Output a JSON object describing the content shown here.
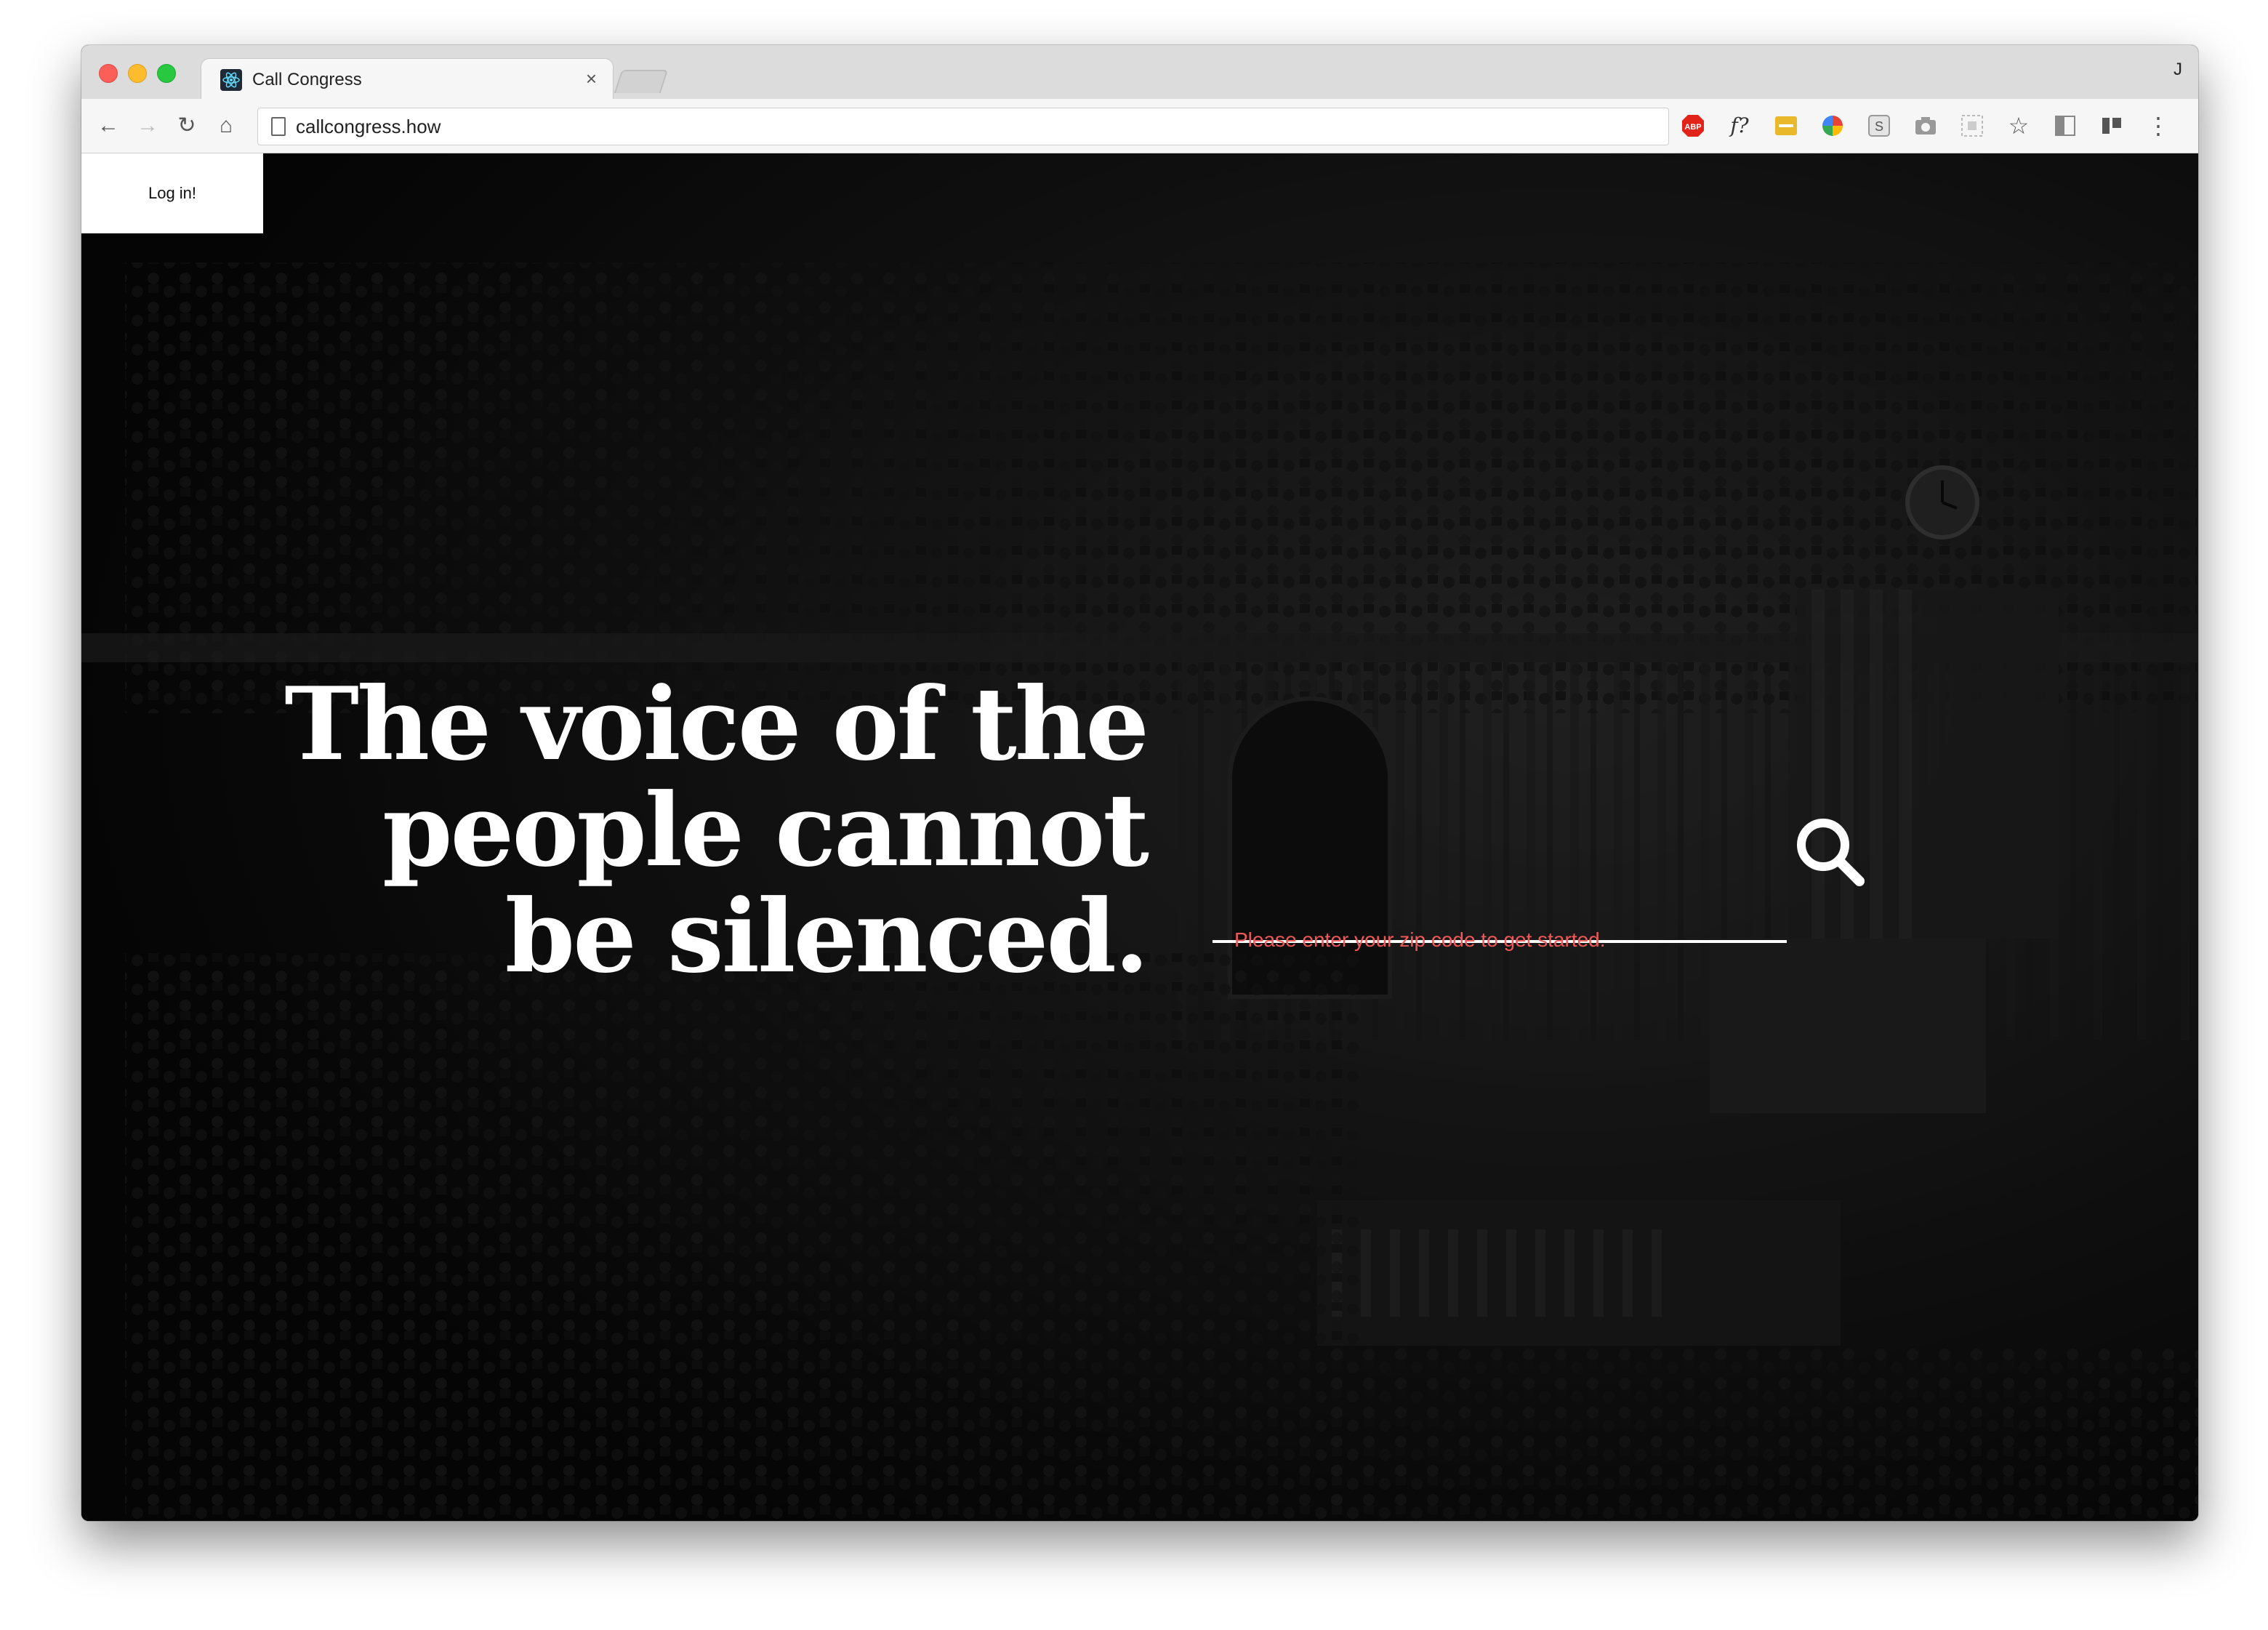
{
  "browser": {
    "tab_title": "Call Congress",
    "tab_close": "×",
    "profile_initial": "J",
    "url": "callcongress.how",
    "nav": {
      "back": "←",
      "forward": "→",
      "reload": "↻",
      "home": "⌂"
    },
    "extensions": [
      {
        "name": "adblock-plus-icon",
        "label": "ABP",
        "color": "#e2231a"
      },
      {
        "name": "font-identifier-icon",
        "label": "f?",
        "color": "#333333"
      },
      {
        "name": "extension-yellow-icon",
        "label": "···",
        "color": "#e9b82b"
      },
      {
        "name": "color-picker-icon",
        "label": "",
        "color": "#34a853"
      },
      {
        "name": "s-extension-icon",
        "label": "S",
        "color": "#666666"
      },
      {
        "name": "camera-icon",
        "label": "",
        "color": "#888888"
      },
      {
        "name": "grid-extension-icon",
        "label": "",
        "color": "#aaaaaa"
      },
      {
        "name": "bookmark-star-icon",
        "label": "☆",
        "color": "#555555"
      },
      {
        "name": "sidebar-extension-icon",
        "label": "",
        "color": "#888888"
      },
      {
        "name": "reader-extension-icon",
        "label": "",
        "color": "#555555"
      },
      {
        "name": "menu-kebab-icon",
        "label": "⋮",
        "color": "#555555"
      }
    ]
  },
  "page": {
    "login_label": "Log in!",
    "headline": "The voice of the people cannot be silenced.",
    "zip_placeholder": "",
    "helper_text": "Please enter your zip code to get started.",
    "helper_color": "#f0585a"
  }
}
